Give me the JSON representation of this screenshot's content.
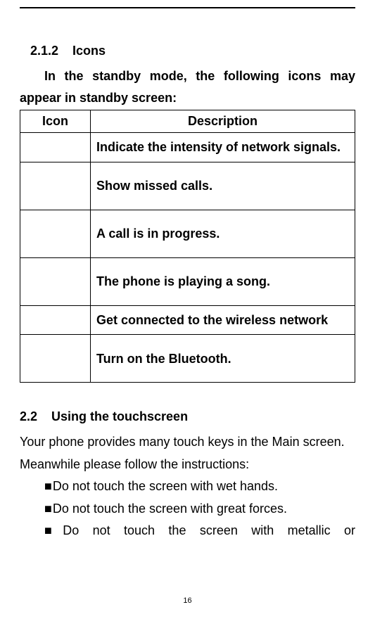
{
  "section1": {
    "number": "2.1.2",
    "title": "Icons",
    "intro": "In the standby mode, the following icons may appear in standby screen:"
  },
  "table": {
    "headers": {
      "col1": "Icon",
      "col2": "Description"
    },
    "rows": [
      {
        "desc": "Indicate the intensity of network signals."
      },
      {
        "desc": "Show missed calls."
      },
      {
        "desc": "A call is in progress."
      },
      {
        "desc": "The phone is playing a song."
      },
      {
        "desc": "Get connected to the wireless network"
      },
      {
        "desc": "Turn on the Bluetooth."
      }
    ]
  },
  "section2": {
    "number": "2.2",
    "title": "Using the touchscreen",
    "body": "Your phone provides many touch keys in the Main screen. Meanwhile please follow the instructions:",
    "bullets": [
      "Do not touch the screen with wet hands.",
      "Do not touch the screen with great forces.",
      "Do not touch the screen with metallic or"
    ]
  },
  "page_number": "16"
}
